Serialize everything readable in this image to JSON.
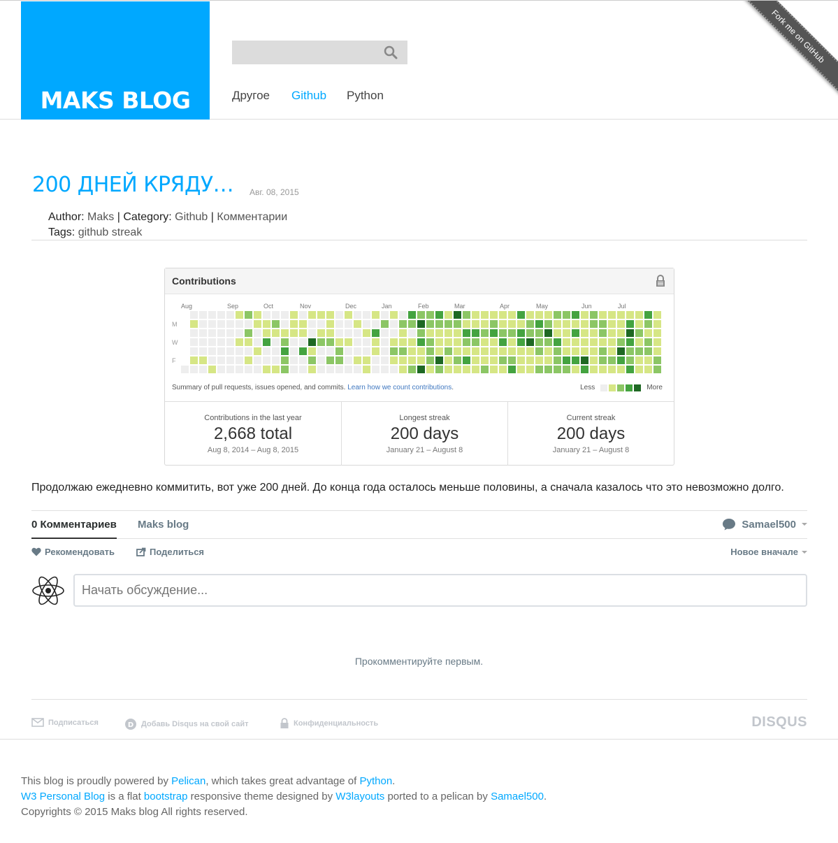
{
  "site": {
    "title": "MAKS BLOG",
    "nav": [
      {
        "label": "Другое",
        "active": false
      },
      {
        "label": "Github",
        "active": true
      },
      {
        "label": "Python",
        "active": false
      }
    ],
    "search_placeholder": "",
    "ribbon": "Fork me on GitHub"
  },
  "post": {
    "title": "200 ДНЕЙ КРЯДУ…",
    "date": "Авг. 08, 2015",
    "author_label": "Author:",
    "author": "Maks",
    "sep1": "|",
    "category_label": "Category:",
    "category": "Github",
    "sep2": "|",
    "comments_link": "Комментарии",
    "tags_label": "Tags:",
    "tags": "github streak",
    "body": "Продолжаю ежедневно коммитить, вот уже 200 дней. До конца года осталось меньше половины, а сначала казалось что это невозможно долго."
  },
  "contributions": {
    "title": "Contributions",
    "months": [
      "Aug",
      "Sep",
      "Oct",
      "Nov",
      "Dec",
      "Jan",
      "Feb",
      "Mar",
      "Apr",
      "May",
      "Jun",
      "Jul"
    ],
    "day_labels": [
      "M",
      "W",
      "F"
    ],
    "summary_text": "Summary of pull requests, issues opened, and commits.",
    "summary_link": "Learn how we count contributions",
    "summary_end": ".",
    "legend_less": "Less",
    "legend_more": "More",
    "colors": [
      "#eeeeee",
      "#d6e685",
      "#8cc665",
      "#44a340",
      "#1e6823"
    ],
    "stats": [
      {
        "label": "Contributions in the last year",
        "value": "2,668 total",
        "sub": "Aug 8, 2014 – Aug 8, 2015"
      },
      {
        "label": "Longest streak",
        "value": "200 days",
        "sub": "January 21 – August 8"
      },
      {
        "label": "Current streak",
        "value": "200 days",
        "sub": "January 21 – August 8"
      }
    ]
  },
  "disqus": {
    "tab_comments": "0 Комментариев",
    "tab_site": "Maks blog",
    "user": "Samael500",
    "recommend": "Рекомендовать",
    "share": "Поделиться",
    "sort": "Новое вначале",
    "comment_placeholder": "Начать обсуждение...",
    "empty": "Прокомментируйте первым.",
    "subscribe": "Подписаться",
    "add_disqus": "Добавь Disqus на свой сайт",
    "privacy": "Конфиденциальность",
    "brand": "DISQUS"
  },
  "footer": {
    "l1a": "This blog is proudly powered by ",
    "l1_link1": "Pelican",
    "l1b": ", which takes great advantage of ",
    "l1_link2": "Python",
    "l1c": ".",
    "l2_link1": "W3 Personal Blog",
    "l2a": " is a flat ",
    "l2_link2": "bootstrap",
    "l2b": " responsive theme designed by ",
    "l2_link3": "W3layouts",
    "l2c": " ported to a pelican by ",
    "l2_link4": "Samael500",
    "l2d": ".",
    "l3": "Copyrights © 2015 Maks blog All rights reserved."
  }
}
